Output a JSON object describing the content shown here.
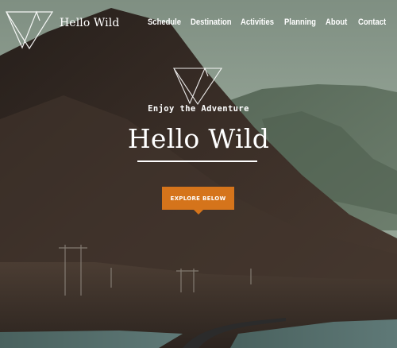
{
  "header": {
    "brand": "Hello Wild"
  },
  "nav": {
    "items": [
      "Schedule",
      "Destination",
      "Activities",
      "Planning",
      "About",
      "Contact"
    ]
  },
  "hero": {
    "tagline": "Enjoy the Adventure",
    "title": "Hello Wild",
    "cta_label": "EXPLORE BELOW"
  },
  "colors": {
    "accent": "#d5741b",
    "text": "#ffffff",
    "mountain_dark": "#2f2620",
    "sky": "#8a9a8c",
    "far_mountain": "#5a6c5c"
  },
  "icons": {
    "logo": "w-triangle-logo-icon",
    "hero_mark": "w-triangle-logo-icon"
  }
}
